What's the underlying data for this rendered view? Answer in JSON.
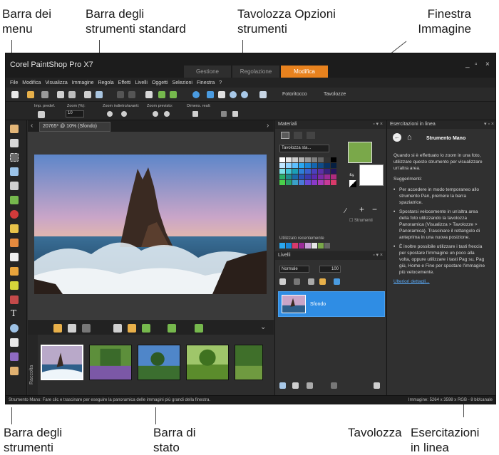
{
  "callouts": {
    "menu_bar": "Barra dei\nmenu",
    "standard_toolbar": "Barra degli\nstrumenti standard",
    "tool_options": "Tavolozza Opzioni\nstrumenti",
    "image_window": "Finestra\nImmagine",
    "tools_toolbar": "Barra degli\nstrumenti",
    "status_bar": "Barra di\nstato",
    "learning_center_prefix": "Tavolozza",
    "learning_center": "Esercitazioni\nin linea"
  },
  "app": {
    "title": "Corel PaintShop Pro X7",
    "workspace_tabs": [
      "Gestione",
      "Regolazione",
      "Modifica"
    ],
    "active_tab": "Modifica",
    "window_controls": [
      "_",
      "▫",
      "×"
    ]
  },
  "menu": [
    "File",
    "Modifica",
    "Visualizza",
    "Immagine",
    "Regola",
    "Effetti",
    "Livelli",
    "Oggetti",
    "Selezioni",
    "Finestra",
    "?"
  ],
  "standard_toolbar": {
    "photo_label": "Fotoritocco",
    "palettes_label": "Tavolozze"
  },
  "tool_options": {
    "labels": [
      "Imp. predef.",
      "Zoom (%):",
      "Zoom indietro/avanti:",
      "Zoom previsto:",
      "Dimens. reali:"
    ],
    "zoom_value": "10"
  },
  "document": {
    "tab_title": "20765* @ 10% (Sfondo)"
  },
  "organizer": {
    "label": "Raccolta"
  },
  "materials": {
    "title": "Materiali",
    "dropdown": "Tavolozza sta...",
    "recent_label": "Utilizzato recentemente",
    "tools_label": "Strumenti",
    "fg_color": "#7aa84a",
    "bg_color": "#ffffff"
  },
  "layers": {
    "title": "Livelli",
    "blend_mode": "Normale",
    "opacity": "100",
    "layer_name": "Sfondo"
  },
  "learning_center": {
    "title": "Esercitazioni in linea",
    "tool_name": "Strumento Mano",
    "intro": "Quando si è effettuato lo zoom in una foto, utilizzare questo strumento per visualizzare un'altra area.",
    "tips_heading": "Suggerimenti:",
    "tips": [
      "Per accedere in modo temporaneo allo strumento Pan, premere la barra spaziatrice.",
      "Spostarsi velocemente in un'altra area della foto utilizzando la tavolozza Panoramica (Visualizza > Tavolozze > Panoramica). Trascinare il rettangolo di anteprima in una nuova posizione.",
      "È inoltre possibile utilizzare i tasti freccia per spostare l'immagine un poco alla volta, oppure utilizzare i tasti Pag su, Pag giù, Home e Fine per spostare l'immagine più velocemente."
    ],
    "more_link": "Ulteriori dettagli..."
  },
  "status_bar": {
    "left": "Strumento Mano: Fare clic e trascinare per eseguire la panoramica delle immagini più grandi della finestra.",
    "right": "Immagine:  5264 x 3598 x RGB - 8 bit/canale"
  },
  "colors": {
    "accent": "#e8821e",
    "selection": "#2f8de4"
  }
}
